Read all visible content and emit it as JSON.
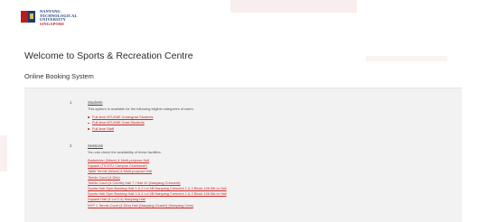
{
  "header": {
    "logo_lines": [
      "NANYANG",
      "TECHNOLOGICAL",
      "UNIVERSITY",
      "SINGAPORE"
    ]
  },
  "page": {
    "title": "Welcome to Sports & Recreation Centre",
    "subtitle": "Online Booking System"
  },
  "section1": {
    "number": "1.",
    "title": "Students",
    "description": "This system is available for the following eligible categories of users:",
    "items": [
      "Full-time NTU/NIE Undergrad Students",
      "Full-time NTU/NIE Grad Students",
      "Full-time Staff"
    ]
  },
  "section2": {
    "number": "2.",
    "title": "Sessions",
    "description": "You can check the availability of these facilities:",
    "items": [
      "Badminton (Wave) & Multi-purpose Hall",
      "Squash (T5 NTU Campus Clubhouse)",
      "Table Tennis (Wave) & Multi-purpose Hall",
      "Tennis Court (4 Dirs)",
      "Tennis Court (4 Courts) Hall 7 / Hall 10 (Nanyang Crescent)",
      "Sports Hall Gym Booking Hall 1 & 2 Lvl 4B Nanyang Crescent 1 & 2 Block 106 Blk to Hall",
      "Sports Hall Gym Booking Hall 3 & 4 Lvl 4B Nanyang Crescent 1 & 2 Block 106 Blk to Hall",
      "Squash Hall (4 Lvl 2-4) Nanyang Hall",
      "NYP 1 Tennis Court (4 Dirs) Hall (Nanyang Cluster) (Nanyang Cres)"
    ]
  },
  "colors": {
    "accent_red": "#cc2a2a",
    "panel_bg": "#f2f2f2",
    "logo_blue": "#1c3a7a",
    "logo_red": "#b81d1d"
  }
}
